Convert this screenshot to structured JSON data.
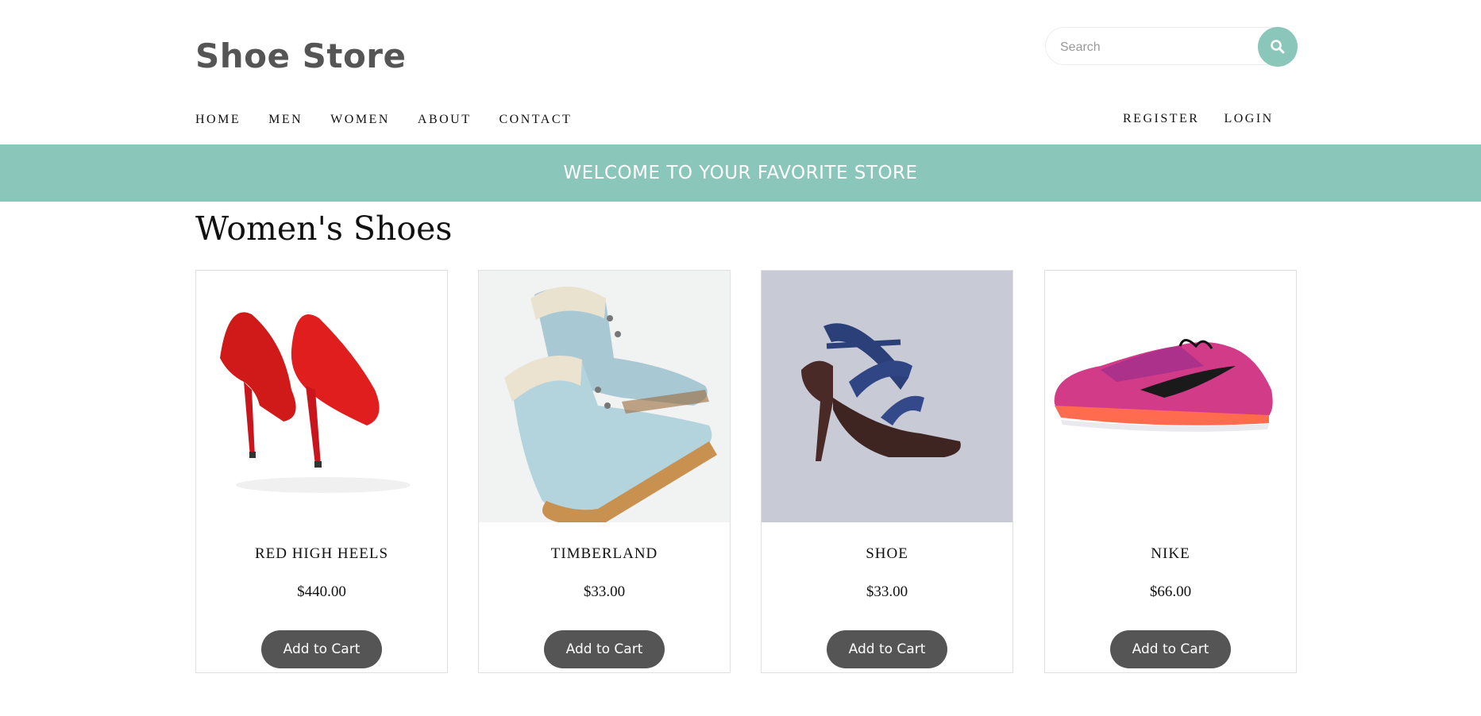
{
  "header": {
    "logo": "Shoe Store"
  },
  "search": {
    "placeholder": "Search",
    "icon": "search-icon"
  },
  "nav": {
    "left": [
      "HOME",
      "MEN",
      "WOMEN",
      "ABOUT",
      "CONTACT"
    ],
    "right": [
      "REGISTER",
      "LOGIN"
    ]
  },
  "banner": {
    "text": "WELCOME TO YOUR FAVORITE STORE"
  },
  "page": {
    "title": "Women's Shoes"
  },
  "colors": {
    "accent": "#8ac6b9",
    "button": "#555555"
  },
  "products": [
    {
      "name": "RED HIGH HEELS",
      "price": "$440.00",
      "button": "Add to Cart",
      "image": "red-high-heels-image"
    },
    {
      "name": "TIMBERLAND",
      "price": "$33.00",
      "button": "Add to Cart",
      "image": "blue-boots-image"
    },
    {
      "name": "SHOE",
      "price": "$33.00",
      "button": "Add to Cart",
      "image": "blue-sandal-heel-image"
    },
    {
      "name": "NIKE",
      "price": "$66.00",
      "button": "Add to Cart",
      "image": "pink-sneaker-image"
    }
  ]
}
